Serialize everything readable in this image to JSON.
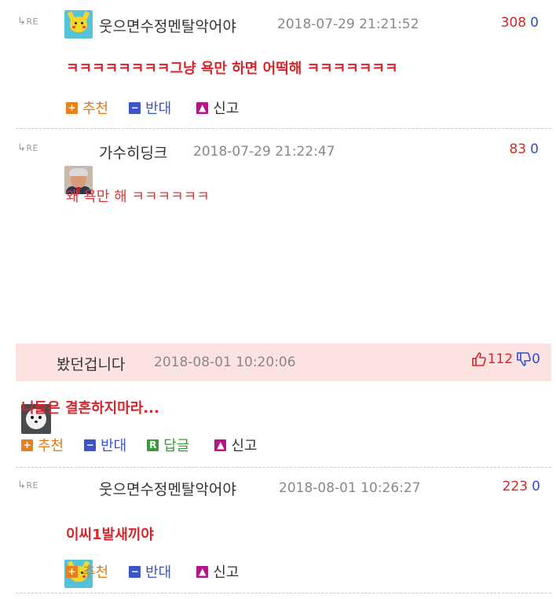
{
  "comments": [
    {
      "reply_tag": "RE",
      "nickname": "웃으면수정멘탈악어야",
      "date": "2018-07-29 21:21:52",
      "up": "308",
      "down": "0",
      "body": "ㅋㅋㅋㅋㅋㅋㅋㅋ그냥 욕만 하면 어떡해 ㅋㅋㅋㅋㅋㅋㅋ",
      "actions": [
        "추천",
        "반대",
        "신고"
      ]
    },
    {
      "reply_tag": "RE",
      "nickname": "가수히딩크",
      "date": "2018-07-29 21:22:47",
      "up": "83",
      "down": "0",
      "body": "왜 욕만 해 ㅋㅋㅋㅋㅋㅋ"
    },
    {
      "nickname": "봤던겁니다",
      "date": "2018-08-01 10:20:06",
      "up": "112",
      "down": "0",
      "body": "니들은 결혼하지마라...",
      "actions": [
        "추천",
        "반대",
        "답글",
        "신고"
      ]
    },
    {
      "reply_tag": "RE",
      "nickname": "웃으면수정멘탈악어야",
      "date": "2018-08-01 10:26:27",
      "up": "223",
      "down": "0",
      "body": "이씨1발새끼야",
      "actions": [
        "추천",
        "반대",
        "신고"
      ]
    }
  ],
  "icons": {
    "recommend": "plus-box-icon",
    "oppose": "minus-box-icon",
    "reply": "r-box-icon",
    "report": "siren-icon",
    "thumbs_up": "thumbs-up-icon",
    "thumbs_down": "thumbs-down-icon",
    "reply_arrow": "reply-arrow-icon"
  },
  "colors": {
    "up_count": "#d8242a",
    "down_count": "#2b4fd6",
    "recommend": "#e07a1a",
    "oppose": "#3a55c8",
    "reply": "#3c9a3c",
    "report": "#b0188a",
    "highlight_row": "#fde2e2"
  }
}
